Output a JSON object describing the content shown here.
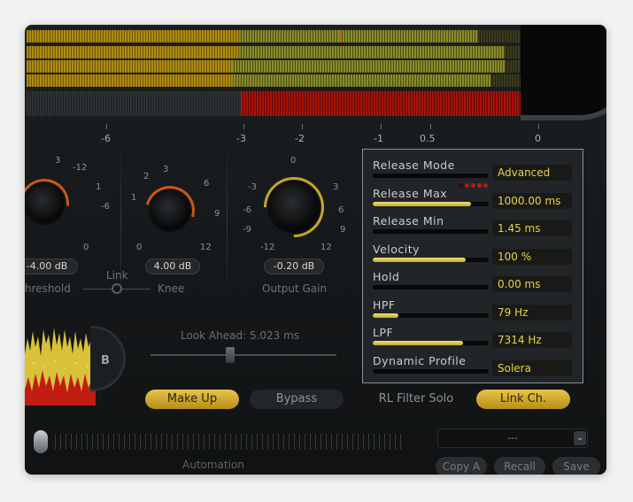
{
  "meter": {
    "scale": [
      {
        "label": "-6"
      },
      {
        "label": "-3"
      },
      {
        "label": "-2"
      },
      {
        "label": "-1"
      },
      {
        "label": "0.5"
      },
      {
        "label": "0"
      }
    ]
  },
  "knobs": {
    "threshold": {
      "label": "hreshold",
      "value": "-4.00 dB",
      "ticks": [
        "3",
        "-12",
        "1",
        "-6",
        "0"
      ]
    },
    "knee": {
      "label": "Knee",
      "value": "4.00 dB",
      "ticks": [
        "2",
        "3",
        "6",
        "1",
        "9",
        "0",
        "12"
      ]
    },
    "output_gain": {
      "label": "Output Gain",
      "value": "-0.20 dB",
      "ticks": [
        "0",
        "-3",
        "3",
        "-6",
        "6",
        "-9",
        "9",
        "-12",
        "12"
      ]
    },
    "link_label": "Link"
  },
  "display": {
    "b_label": "B"
  },
  "lookahead": {
    "label": "Look Ahead: 5.023 ms",
    "position_percent": 43
  },
  "buttons": {
    "make_up": "Make Up",
    "bypass": "Bypass",
    "rl_filter_solo": "RL Filter Solo",
    "link_ch": "Link Ch."
  },
  "bottom": {
    "automation_label": "Automation",
    "preset_value": "---",
    "copy_a": "Copy A",
    "recall": "Recall",
    "save": "Save"
  },
  "popup": {
    "rows": [
      {
        "label": "Release Mode",
        "value": "Advanced",
        "fill_percent": 0
      },
      {
        "label": "Release Max",
        "value": "1000.00 ms",
        "fill_percent": 85
      },
      {
        "label": "Release Min",
        "value": "1.45 ms",
        "fill_percent": 0
      },
      {
        "label": "Velocity",
        "value": "100 %",
        "fill_percent": 80
      },
      {
        "label": "Hold",
        "value": "0.00 ms",
        "fill_percent": 0
      },
      {
        "label": "HPF",
        "value": "79 Hz",
        "fill_percent": 22
      },
      {
        "label": "LPF",
        "value": "7314 Hz",
        "fill_percent": 78
      },
      {
        "label": "Dynamic Profile",
        "value": "Solera",
        "fill_percent": 0
      }
    ]
  },
  "colors": {
    "accent_yellow": "#e8c44a",
    "meter_red": "#a8140c",
    "value_text": "#e7d24a"
  }
}
